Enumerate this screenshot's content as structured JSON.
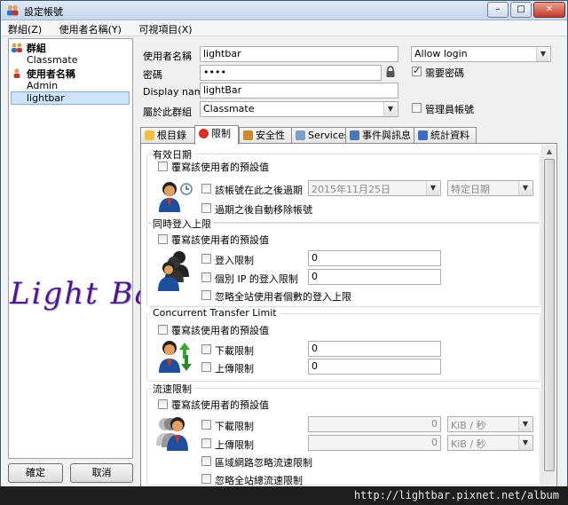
{
  "window": {
    "title": "設定帳號",
    "controls": {
      "minimize": "–",
      "maximize": "□",
      "close": "✕"
    }
  },
  "menu": {
    "items": [
      "群組(Z)",
      "使用者名稱(Y)",
      "可視項目(X)"
    ]
  },
  "tree": {
    "groups_header": "群組",
    "groups": [
      "Classmate"
    ],
    "users_header": "使用者名稱",
    "users": [
      "Admin",
      "lightbar"
    ]
  },
  "watermark": "Light Bar",
  "left_buttons": {
    "ok": "確定",
    "cancel": "取消"
  },
  "form": {
    "username_label": "使用者名稱",
    "username_value": "lightbar",
    "password_label": "密碼",
    "password_value": "••••",
    "display_name_label": "Display name",
    "display_name_value": "lightBar",
    "group_label": "屬於此群組",
    "group_value": "Classmate",
    "login_select_value": "Allow login",
    "require_password_label": "需要密碼",
    "admin_account_label": "管理員帳號",
    "require_password_checked": true,
    "admin_account_checked": false
  },
  "tabs": [
    "根目錄",
    "限制",
    "安全性",
    "Services",
    "事件與訊息",
    "統計資料"
  ],
  "active_tab": "限制",
  "sections": {
    "expiry": {
      "title": "有效日期",
      "override_label": "覆寫該使用者的預設值",
      "expire_label": "該帳號在此之後過期",
      "date_value": "2015年11月25日",
      "date_type_value": "特定日期",
      "auto_remove_label": "過期之後自動移除帳號"
    },
    "login_limit": {
      "title": "同時登入上限",
      "override_label": "覆寫該使用者的預設值",
      "login_limit_label": "登入限制",
      "login_limit_value": "0",
      "per_ip_label": "個別 IP 的登入限制",
      "per_ip_value": "0",
      "ignore_label": "忽略全站使用者個數的登入上限"
    },
    "transfer_limit": {
      "title": "Concurrent Transfer Limit",
      "override_label": "覆寫該使用者的預設值",
      "download_label": "下載限制",
      "download_value": "0",
      "upload_label": "上傳限制",
      "upload_value": "0"
    },
    "speed_limit": {
      "title": "流速限制",
      "override_label": "覆寫該使用者的預設值",
      "download_label": "下載限制",
      "download_value": "0",
      "download_unit": "KiB / 秒",
      "upload_label": "上傳限制",
      "upload_value": "0",
      "upload_unit": "KiB / 秒",
      "lan_ignore_label": "區域網路忽略流速限制",
      "global_ignore_label": "忽略全站總流速限制"
    }
  },
  "footer_url": "http://lightbar.pixnet.net/album"
}
